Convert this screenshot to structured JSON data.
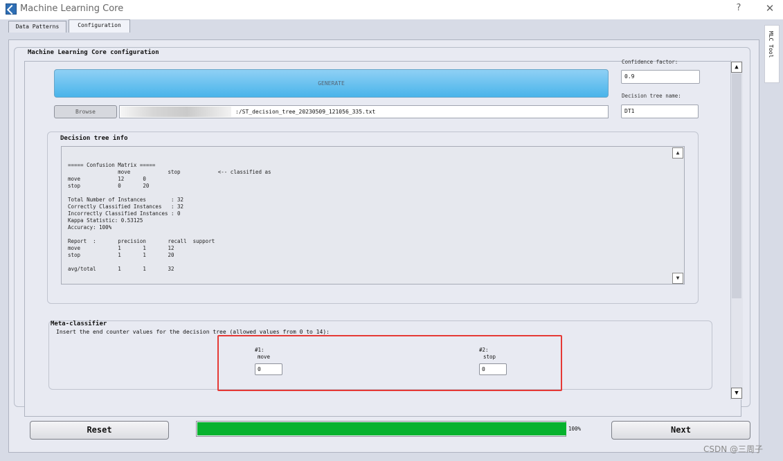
{
  "app": {
    "title": "Machine Learning Core",
    "help_glyph": "?",
    "close_glyph": "✕"
  },
  "tabs": [
    {
      "label": "Data Patterns",
      "active": false
    },
    {
      "label": "Configuration",
      "active": true
    }
  ],
  "side_tab": {
    "label": "MLC Tool"
  },
  "config": {
    "title": "Machine Learning Core configuration",
    "generate_label": "GENERATE",
    "browse_label": "Browse",
    "file_path_visible": ":/ST_decision_tree_20230509_121056_335.txt",
    "confidence_label": "Confidence factor:",
    "confidence_value": "0.9",
    "tree_name_label": "Decision tree name:",
    "tree_name_value": "DT1"
  },
  "decision_tree_info": {
    "title": "Decision tree info",
    "text": "===== Confusion Matrix =====\n                move            stop            <-- classified as\nmove            12      0\nstop            0       20\n\nTotal Number of Instances        : 32\nCorrectly Classified Instances   : 32\nIncorrectly Classified Instances : 0\nKappa Statistic: 0.53125\nAccuracy: 100%\n\nReport  :       precision       recall  support\nmove            1       1       12\nstop            1       1       20\n\navg/total       1       1       32"
  },
  "meta_classifier": {
    "title": "Meta-classifier",
    "description": "Insert the end counter values for the decision tree (allowed values from 0 to 14):",
    "counters": [
      {
        "index": "#1:",
        "class": "move",
        "value": "0"
      },
      {
        "index": "#2:",
        "class": "stop",
        "value": "0"
      }
    ]
  },
  "footer": {
    "reset_label": "Reset",
    "next_label": "Next",
    "progress_percent": 100,
    "progress_label": "100%"
  },
  "watermark": "CSDN @三周子",
  "colors": {
    "generate_button": "#5bbdf0",
    "progress_fill": "#06b22e",
    "highlight_border": "#e53935"
  }
}
